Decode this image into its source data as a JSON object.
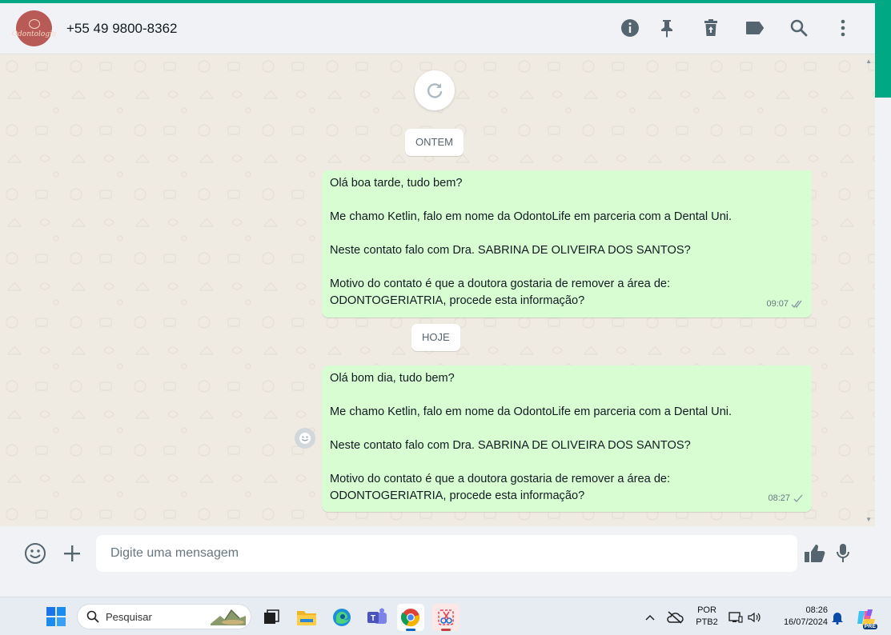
{
  "header": {
    "contact_name": "+55 49 9800-8362",
    "avatar_text": "Odontologia",
    "icons": [
      "info-icon",
      "pin-icon",
      "delete-icon",
      "label-icon",
      "search-icon",
      "more-icon"
    ]
  },
  "chat": {
    "date_chips": [
      "ONTEM",
      "HOJE"
    ],
    "messages": [
      {
        "lines": [
          "Olá boa tarde, tudo bem?",
          "",
          "Me chamo Ketlin, falo em nome da OdontoLife em parceria com a Dental Uni.",
          "",
          "Neste contato falo com Dra. SABRINA DE OLIVEIRA DOS SANTOS?",
          "",
          "Motivo do contato é que a doutora gostaria de remover a área de:",
          "ODONTOGERIATRIA, procede esta informação?"
        ],
        "time": "09:07",
        "status": "delivered"
      },
      {
        "lines": [
          "Olá bom dia, tudo bem?",
          "",
          "Me chamo Ketlin, falo em nome da OdontoLife em parceria com a Dental Uni.",
          "",
          "Neste contato falo com Dra. SABRINA DE OLIVEIRA DOS SANTOS?",
          "",
          "Motivo do contato é que a doutora gostaria de remover a área de:",
          "ODONTOGERIATRIA, procede esta informação?"
        ],
        "time": "08:27",
        "status": "sent"
      }
    ]
  },
  "composer": {
    "placeholder": "Digite uma mensagem"
  },
  "taskbar": {
    "search_placeholder": "Pesquisar",
    "apps": [
      "task-view-icon",
      "file-explorer-icon",
      "edge-icon",
      "teams-icon",
      "chrome-icon",
      "snipping-tool-icon"
    ],
    "language_line1": "POR",
    "language_line2": "PTB2",
    "time": "08:26",
    "date": "16/07/2024",
    "copilot_badge": "PRE"
  },
  "colors": {
    "accent": "#00a884",
    "outgoing_bubble": "#d9fdd3",
    "chat_bg": "#efeae2"
  }
}
